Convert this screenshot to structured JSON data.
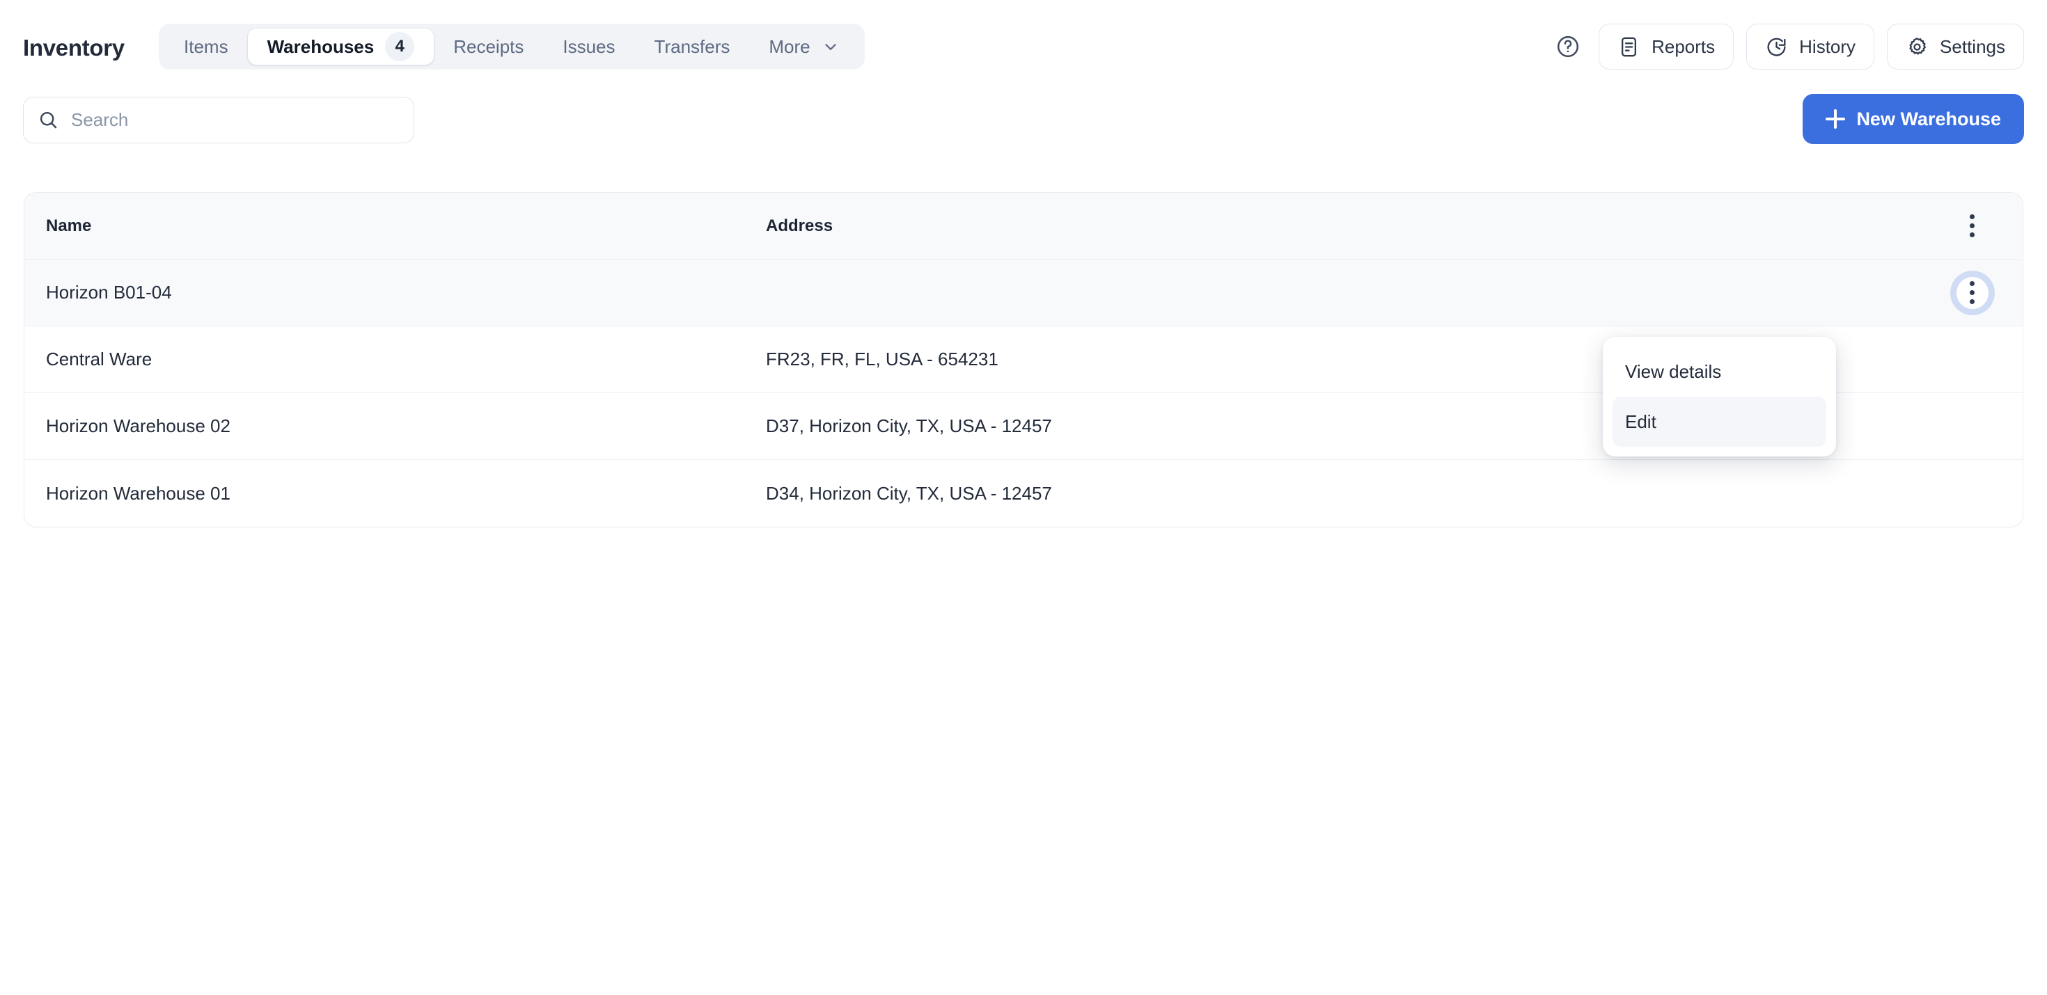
{
  "app": {
    "title": "Inventory",
    "accent_color": "#3b6fe0"
  },
  "tabs": [
    {
      "label": "Items",
      "badge": "",
      "active": false,
      "caret": false
    },
    {
      "label": "Warehouses",
      "badge": "4",
      "active": true,
      "caret": false
    },
    {
      "label": "Receipts",
      "badge": "",
      "active": false,
      "caret": false
    },
    {
      "label": "Issues",
      "badge": "",
      "active": false,
      "caret": false
    },
    {
      "label": "Transfers",
      "badge": "",
      "active": false,
      "caret": false
    },
    {
      "label": "More",
      "badge": "",
      "active": false,
      "caret": true
    }
  ],
  "top_actions": {
    "help_icon": "help-circle-icon",
    "buttons": [
      {
        "label": "Reports",
        "icon": "document-report-icon"
      },
      {
        "label": "History",
        "icon": "clock-history-icon"
      },
      {
        "label": "Settings",
        "icon": "gear-icon"
      }
    ]
  },
  "search": {
    "icon": "search-icon",
    "value": "",
    "placeholder": "Search"
  },
  "new_button": {
    "label": "New Warehouse",
    "icon": "plus-icon"
  },
  "table": {
    "columns": [
      "Name",
      "Address"
    ],
    "header_action_icon": "kebab-menu-icon",
    "rows": [
      {
        "name": "Horizon B01-04",
        "address": ""
      },
      {
        "name": "Central Ware",
        "address": "FR23, FR, FL, USA - 654231"
      },
      {
        "name": "Horizon Warehouse 02",
        "address": "D37, Horizon City, TX, USA - 12457"
      },
      {
        "name": "Horizon Warehouse 01",
        "address": "D34, Horizon City, TX, USA - 12457"
      }
    ]
  },
  "context_menu": {
    "items": [
      {
        "label": "View details",
        "hovered": false
      },
      {
        "label": "Edit",
        "hovered": true
      }
    ]
  }
}
